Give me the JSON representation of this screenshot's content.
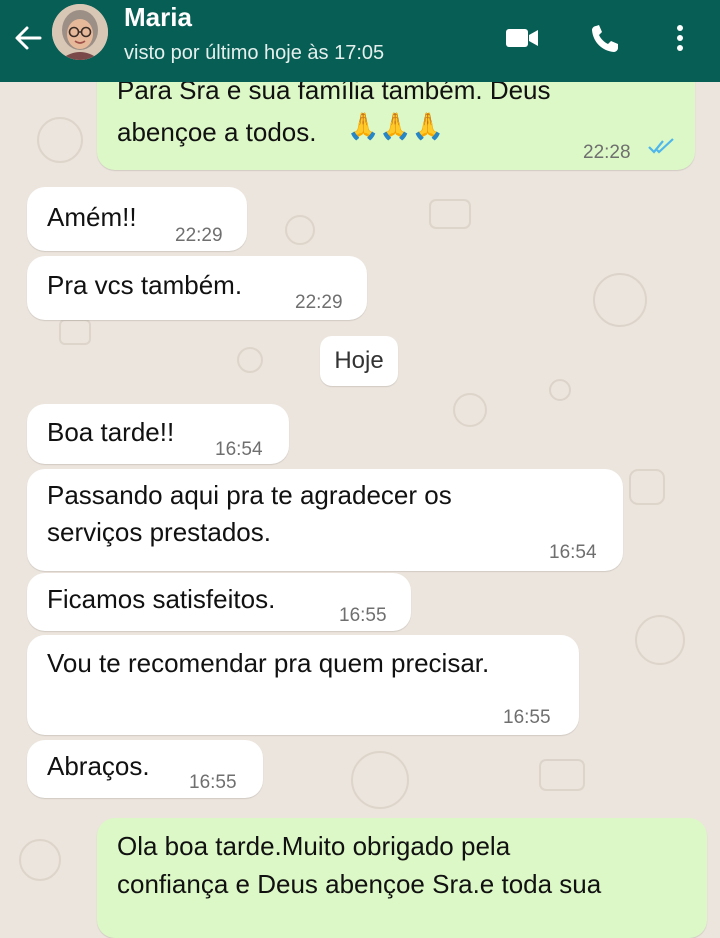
{
  "header": {
    "contact_name": "Maria",
    "status": "visto por último hoje às 17:05",
    "back_icon": "arrow-left-icon",
    "video_icon": "video-camera-icon",
    "call_icon": "phone-icon",
    "menu_icon": "more-vertical-icon",
    "bar_color": "#075e54"
  },
  "colors": {
    "outgoing_bubble": "#dcf8c6",
    "incoming_bubble": "#ffffff",
    "chat_background": "#ece5dd",
    "read_ticks": "#4fb6ec"
  },
  "messages": [
    {
      "direction": "out",
      "lines": [
        "Para Sra e sua família também. Deus",
        "abençoe a todos."
      ],
      "emoji": "🙏🙏🙏",
      "time": "22:28",
      "status": "read"
    },
    {
      "direction": "in",
      "text": "Amém!!",
      "time": "22:29"
    },
    {
      "direction": "in",
      "text": "Pra vcs também.",
      "time": "22:29"
    },
    {
      "direction": "in",
      "text": "Boa tarde!!",
      "time": "16:54"
    },
    {
      "direction": "in",
      "lines": [
        "Passando aqui pra  te agradecer  os",
        "serviços  prestados."
      ],
      "time": "16:54"
    },
    {
      "direction": "in",
      "text": "Ficamos satisfeitos.",
      "time": "16:55"
    },
    {
      "direction": "in",
      "text": "Vou te recomendar  pra quem precisar.",
      "time": "16:55"
    },
    {
      "direction": "in",
      "text": "Abraços.",
      "time": "16:55"
    },
    {
      "direction": "out",
      "lines": [
        "Ola boa tarde.Muito obrigado pela",
        "confiança e Deus abençoe Sra.e toda sua"
      ]
    }
  ],
  "date_divider": "Hoje"
}
